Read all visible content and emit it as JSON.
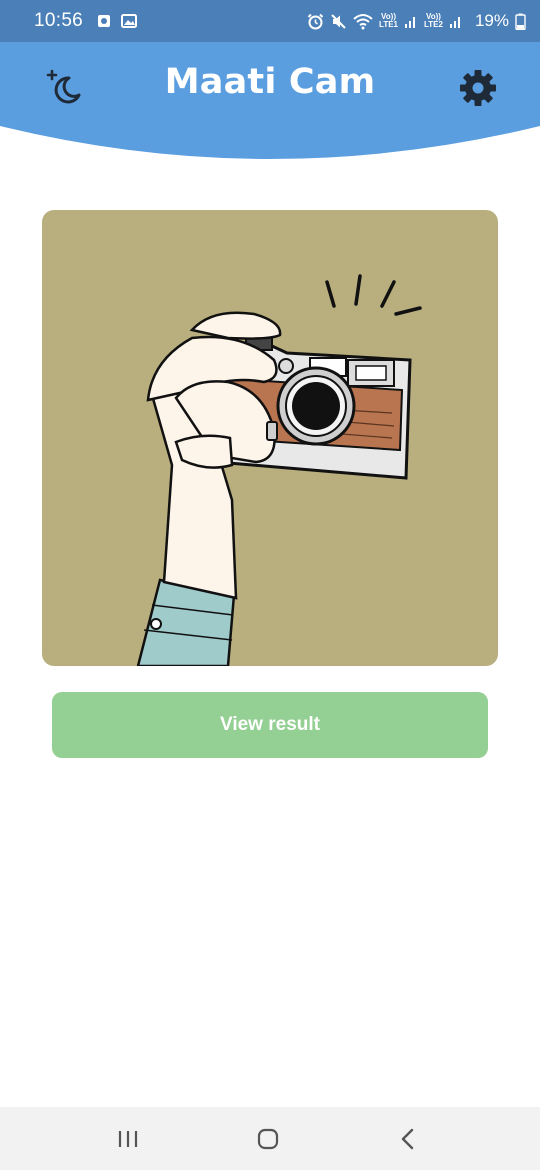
{
  "status_bar": {
    "time": "10:56",
    "battery": "19%",
    "sim1_label_top": "Vo))",
    "sim1_label_bottom": "LTE1",
    "sim2_label_top": "Vo))",
    "sim2_label_bottom": "LTE2",
    "icons": [
      "camera-notification-icon",
      "gallery-notification-icon",
      "alarm-icon",
      "mute-icon",
      "wifi-icon",
      "signal-icon",
      "battery-icon"
    ]
  },
  "header": {
    "title": "Maati Cam",
    "left_icon": "moon-star-icon",
    "right_icon": "gear-icon",
    "background_color": "#5b9ee0"
  },
  "main": {
    "image_description_icon": "hand-holding-camera-illustration",
    "image_background": "#b8ae7e",
    "button_label": "View result",
    "button_color": "#94cf94"
  },
  "nav_bar": {
    "icons": [
      "recent-apps-icon",
      "home-icon",
      "back-icon"
    ]
  }
}
